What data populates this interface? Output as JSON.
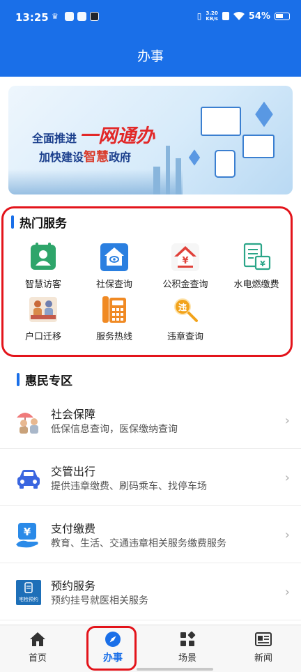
{
  "status_bar": {
    "time": "13:25",
    "net_speed_value": "3.20",
    "net_speed_unit": "KB/s",
    "battery": "54%"
  },
  "app_bar": {
    "title": "办事"
  },
  "banner": {
    "line1_prefix": "全面推进",
    "line1_big": "一网通办",
    "line2_prefix": "加快建设",
    "line2_accent": "智慧",
    "line2_suffix": "政府"
  },
  "hot_services": {
    "title": "热门服务",
    "items": [
      {
        "label": "智慧访客",
        "icon": "visitor-icon",
        "color": "#2ea56a"
      },
      {
        "label": "社保查询",
        "icon": "social-security-icon",
        "color": "#2a7fe0"
      },
      {
        "label": "公积金查询",
        "icon": "housing-fund-icon",
        "color": "#e0413a"
      },
      {
        "label": "水电燃缴费",
        "icon": "utility-bill-icon",
        "color": "#2aa588"
      },
      {
        "label": "户口迁移",
        "icon": "household-registration-icon",
        "color": "#d98a4a"
      },
      {
        "label": "服务热线",
        "icon": "service-hotline-icon",
        "color": "#f08a24"
      },
      {
        "label": "违章查询",
        "icon": "violation-query-icon",
        "color": "#f2a31b"
      }
    ]
  },
  "welfare": {
    "title": "惠民专区",
    "items": [
      {
        "title": "社会保障",
        "subtitle": "低保信息查询，医保缴纳查询",
        "icon": "social-welfare-icon"
      },
      {
        "title": "交管出行",
        "subtitle": "提供违章缴费、刷码乘车、找停车场",
        "icon": "car-icon"
      },
      {
        "title": "支付缴费",
        "subtitle": "教育、生活、交通违章相关服务缴费服务",
        "icon": "payment-icon"
      },
      {
        "title": "预约服务",
        "subtitle": "预约挂号就医相关服务",
        "icon": "appointment-icon",
        "icon_text": "宅检预约"
      }
    ]
  },
  "tab_bar": {
    "tabs": [
      {
        "label": "首页",
        "icon": "home-icon"
      },
      {
        "label": "办事",
        "icon": "compass-icon",
        "active": true
      },
      {
        "label": "场景",
        "icon": "grid-icon"
      },
      {
        "label": "新闻",
        "icon": "news-icon"
      }
    ]
  },
  "colors": {
    "primary": "#1a6fe8",
    "highlight": "#e3141b"
  }
}
